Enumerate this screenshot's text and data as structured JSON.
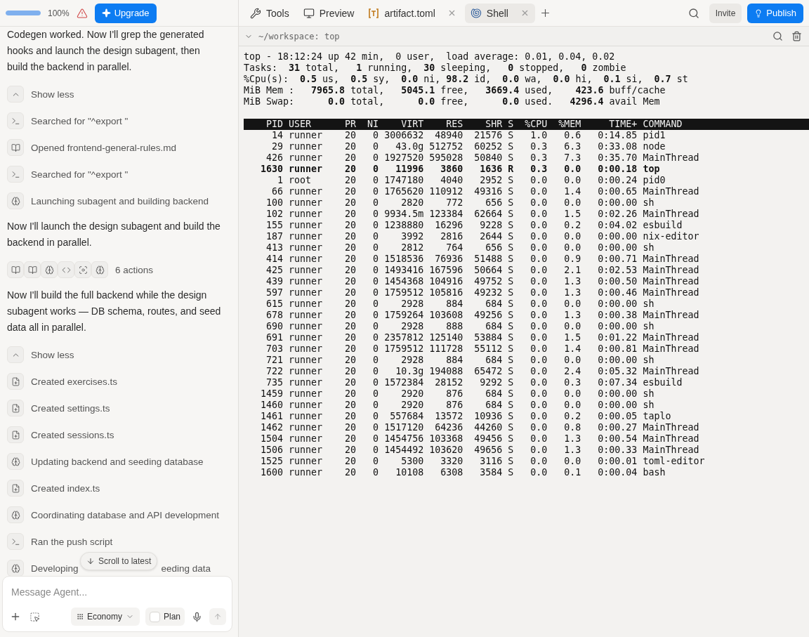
{
  "top_bar": {
    "usage": {
      "level": 1,
      "reading": "100%"
    },
    "upgrade_button": "Upgrade"
  },
  "chat": [
    {
      "kind": "text",
      "text": "Codegen worked. Now I'll grep the generated hooks and launch the design subagent, then build the backend in parallel."
    },
    {
      "kind": "toggle",
      "label": "Show less"
    },
    {
      "kind": "terminal",
      "label": "Searched for \"^export \""
    },
    {
      "kind": "book",
      "label": "Opened frontend-general-rules.md"
    },
    {
      "kind": "terminal",
      "label": "Searched for \"^export \""
    },
    {
      "kind": "subagent",
      "label": "Launching subagent and building backend"
    },
    {
      "kind": "text",
      "text": "Now I'll launch the design subagent and build the backend in parallel."
    },
    {
      "kind": "group",
      "icons": [
        {
          "kind": "book"
        },
        {
          "kind": "book"
        },
        {
          "kind": "subagent"
        },
        {
          "kind": "code"
        },
        {
          "kind": "focus"
        },
        {
          "kind": "subagent"
        }
      ],
      "label": "6 actions"
    },
    {
      "kind": "text",
      "text": "Now I'll build the full backend while the design subagent works — DB schema, routes, and seed data all in parallel."
    },
    {
      "kind": "toggle",
      "label": "Show less"
    },
    {
      "kind": "file",
      "label": "Created exercises.ts"
    },
    {
      "kind": "file",
      "label": "Created settings.ts"
    },
    {
      "kind": "file",
      "label": "Created sessions.ts"
    },
    {
      "kind": "subagent",
      "label": "Updating backend and seeding database"
    },
    {
      "kind": "file",
      "label": "Created index.ts"
    },
    {
      "kind": "subagent",
      "label": "Coordinating database and API development"
    },
    {
      "kind": "terminal",
      "label": "Ran the push script"
    },
    {
      "kind": "subagent",
      "label": "Developing",
      "label_tail": "eeding data"
    }
  ],
  "scroll_button": "Scroll to latest",
  "composer": {
    "placeholder": "Message Agent...",
    "mode": "Economy",
    "plan": {
      "label": "Plan",
      "checked": false
    },
    "send": {
      "disabled": true
    }
  },
  "tabs": [
    {
      "kind": "tools",
      "label": "Tools",
      "selected": false,
      "closable": false
    },
    {
      "kind": "preview",
      "label": "Preview",
      "selected": false,
      "closable": false
    },
    {
      "kind": "file",
      "label": "artifact.toml",
      "selected": false,
      "closable": true
    },
    {
      "kind": "shell",
      "label": "Shell",
      "selected": true,
      "closable": true
    }
  ],
  "invite_button": "Invite",
  "publish_button": "Publish",
  "terminal": {
    "path": "~/workspace: top",
    "summary": [
      "top - 18:12:24 up 42 min,  0 user,  load average: 0.01, 0.04, 0.02",
      "Tasks:  **31** total,   **1** running,  **30** sleeping,   **0** stopped,   **0** zombie",
      "%Cpu(s):  **0.5** us,  **0.5** sy,  **0.0** ni, **98.2** id,  **0.0** wa,  **0.0** hi,  **0.1** si,  **0.7** st",
      "MiB Mem :   **7965.8** total,   **5045.1** free,   **3669.4** used,    **423.6** buff/cache",
      "MiB Swap:      **0.0** total,      **0.0** free,      **0.0** used.   **4296.4** avail Mem"
    ],
    "columns": [
      "PID",
      "USER",
      "PR",
      "NI",
      "VIRT",
      "RES",
      "SHR",
      "S",
      "%CPU",
      "%MEM",
      "TIME+",
      "COMMAND"
    ],
    "rows": [
      {
        "bold": false,
        "cells": [
          "14",
          "runner",
          "20",
          "0",
          "3006632",
          "48940",
          "21576",
          "S",
          "1.0",
          "0.6",
          "0:14.85",
          "pid1"
        ]
      },
      {
        "bold": false,
        "cells": [
          "29",
          "runner",
          "20",
          "0",
          "43.0g",
          "512752",
          "60252",
          "S",
          "0.3",
          "6.3",
          "0:33.08",
          "node"
        ]
      },
      {
        "bold": false,
        "cells": [
          "426",
          "runner",
          "20",
          "0",
          "1927520",
          "595028",
          "50840",
          "S",
          "0.3",
          "7.3",
          "0:35.70",
          "MainThread"
        ]
      },
      {
        "bold": true,
        "cells": [
          "1630",
          "runner",
          "20",
          "0",
          "11996",
          "3860",
          "1636",
          "R",
          "0.3",
          "0.0",
          "0:00.18",
          "top"
        ]
      },
      {
        "bold": false,
        "cells": [
          "1",
          "root",
          "20",
          "0",
          "1747180",
          "4040",
          "2952",
          "S",
          "0.0",
          "0.0",
          "0:00.24",
          "pid0"
        ]
      },
      {
        "bold": false,
        "cells": [
          "66",
          "runner",
          "20",
          "0",
          "1765620",
          "110912",
          "49316",
          "S",
          "0.0",
          "1.4",
          "0:00.65",
          "MainThread"
        ]
      },
      {
        "bold": false,
        "cells": [
          "100",
          "runner",
          "20",
          "0",
          "2820",
          "772",
          "656",
          "S",
          "0.0",
          "0.0",
          "0:00.00",
          "sh"
        ]
      },
      {
        "bold": false,
        "cells": [
          "102",
          "runner",
          "20",
          "0",
          "9934.5m",
          "123384",
          "62664",
          "S",
          "0.0",
          "1.5",
          "0:02.26",
          "MainThread"
        ]
      },
      {
        "bold": false,
        "cells": [
          "155",
          "runner",
          "20",
          "0",
          "1238880",
          "16296",
          "9228",
          "S",
          "0.0",
          "0.2",
          "0:04.02",
          "esbuild"
        ]
      },
      {
        "bold": false,
        "cells": [
          "187",
          "runner",
          "20",
          "0",
          "3992",
          "2816",
          "2644",
          "S",
          "0.0",
          "0.0",
          "0:00.00",
          "nix-editor"
        ]
      },
      {
        "bold": false,
        "cells": [
          "413",
          "runner",
          "20",
          "0",
          "2812",
          "764",
          "656",
          "S",
          "0.0",
          "0.0",
          "0:00.00",
          "sh"
        ]
      },
      {
        "bold": false,
        "cells": [
          "414",
          "runner",
          "20",
          "0",
          "1518536",
          "76936",
          "51488",
          "S",
          "0.0",
          "0.9",
          "0:00.71",
          "MainThread"
        ]
      },
      {
        "bold": false,
        "cells": [
          "425",
          "runner",
          "20",
          "0",
          "1493416",
          "167596",
          "50664",
          "S",
          "0.0",
          "2.1",
          "0:02.53",
          "MainThread"
        ]
      },
      {
        "bold": false,
        "cells": [
          "439",
          "runner",
          "20",
          "0",
          "1454368",
          "104916",
          "49752",
          "S",
          "0.0",
          "1.3",
          "0:00.50",
          "MainThread"
        ]
      },
      {
        "bold": false,
        "cells": [
          "597",
          "runner",
          "20",
          "0",
          "1759512",
          "105816",
          "49232",
          "S",
          "0.0",
          "1.3",
          "0:00.46",
          "MainThread"
        ]
      },
      {
        "bold": false,
        "cells": [
          "615",
          "runner",
          "20",
          "0",
          "2928",
          "884",
          "684",
          "S",
          "0.0",
          "0.0",
          "0:00.00",
          "sh"
        ]
      },
      {
        "bold": false,
        "cells": [
          "678",
          "runner",
          "20",
          "0",
          "1759264",
          "103608",
          "49256",
          "S",
          "0.0",
          "1.3",
          "0:00.38",
          "MainThread"
        ]
      },
      {
        "bold": false,
        "cells": [
          "690",
          "runner",
          "20",
          "0",
          "2928",
          "888",
          "684",
          "S",
          "0.0",
          "0.0",
          "0:00.00",
          "sh"
        ]
      },
      {
        "bold": false,
        "cells": [
          "691",
          "runner",
          "20",
          "0",
          "2357812",
          "125140",
          "53884",
          "S",
          "0.0",
          "1.5",
          "0:01.22",
          "MainThread"
        ]
      },
      {
        "bold": false,
        "cells": [
          "703",
          "runner",
          "20",
          "0",
          "1759512",
          "111728",
          "55112",
          "S",
          "0.0",
          "1.4",
          "0:00.81",
          "MainThread"
        ]
      },
      {
        "bold": false,
        "cells": [
          "721",
          "runner",
          "20",
          "0",
          "2928",
          "884",
          "684",
          "S",
          "0.0",
          "0.0",
          "0:00.00",
          "sh"
        ]
      },
      {
        "bold": false,
        "cells": [
          "722",
          "runner",
          "20",
          "0",
          "10.3g",
          "194088",
          "65472",
          "S",
          "0.0",
          "2.4",
          "0:05.32",
          "MainThread"
        ]
      },
      {
        "bold": false,
        "cells": [
          "735",
          "runner",
          "20",
          "0",
          "1572384",
          "28152",
          "9292",
          "S",
          "0.0",
          "0.3",
          "0:07.34",
          "esbuild"
        ]
      },
      {
        "bold": false,
        "cells": [
          "1459",
          "runner",
          "20",
          "0",
          "2920",
          "876",
          "684",
          "S",
          "0.0",
          "0.0",
          "0:00.00",
          "sh"
        ]
      },
      {
        "bold": false,
        "cells": [
          "1460",
          "runner",
          "20",
          "0",
          "2920",
          "876",
          "684",
          "S",
          "0.0",
          "0.0",
          "0:00.00",
          "sh"
        ]
      },
      {
        "bold": false,
        "cells": [
          "1461",
          "runner",
          "20",
          "0",
          "557684",
          "13572",
          "10936",
          "S",
          "0.0",
          "0.2",
          "0:00.05",
          "taplo"
        ]
      },
      {
        "bold": false,
        "cells": [
          "1462",
          "runner",
          "20",
          "0",
          "1517120",
          "64236",
          "44260",
          "S",
          "0.0",
          "0.8",
          "0:00.27",
          "MainThread"
        ]
      },
      {
        "bold": false,
        "cells": [
          "1504",
          "runner",
          "20",
          "0",
          "1454756",
          "103368",
          "49456",
          "S",
          "0.0",
          "1.3",
          "0:00.54",
          "MainThread"
        ]
      },
      {
        "bold": false,
        "cells": [
          "1506",
          "runner",
          "20",
          "0",
          "1454492",
          "103620",
          "49656",
          "S",
          "0.0",
          "1.3",
          "0:00.33",
          "MainThread"
        ]
      },
      {
        "bold": false,
        "cells": [
          "1525",
          "runner",
          "20",
          "0",
          "5300",
          "3320",
          "3116",
          "S",
          "0.0",
          "0.0",
          "0:00.01",
          "toml-editor"
        ]
      },
      {
        "bold": false,
        "cells": [
          "1600",
          "runner",
          "20",
          "0",
          "10108",
          "6308",
          "3584",
          "S",
          "0.0",
          "0.1",
          "0:00.04",
          "bash"
        ]
      }
    ]
  }
}
